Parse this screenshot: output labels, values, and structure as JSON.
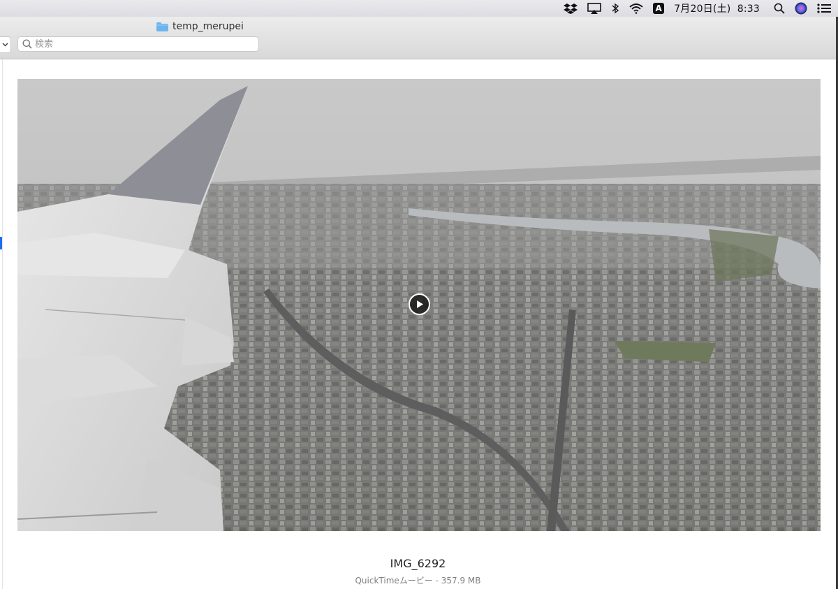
{
  "menubar": {
    "icons": [
      "dropbox-icon",
      "airplay-icon",
      "bluetooth-icon",
      "wifi-icon",
      "input-method-icon",
      "search-icon",
      "siri-icon",
      "notification-center-icon"
    ],
    "input_method": "A",
    "clock": "7月20日(土)  8:33"
  },
  "window": {
    "title": "temp_merupei",
    "title_icon": "folder-icon",
    "search": {
      "placeholder": "検索",
      "value": ""
    }
  },
  "preview": {
    "file_name": "IMG_6292",
    "file_info": "QuickTimeムービー - 357.9 MB",
    "play_icon": "play-icon"
  },
  "colors": {
    "accent": "#1a6ef5",
    "folder": "#6db4ee"
  }
}
